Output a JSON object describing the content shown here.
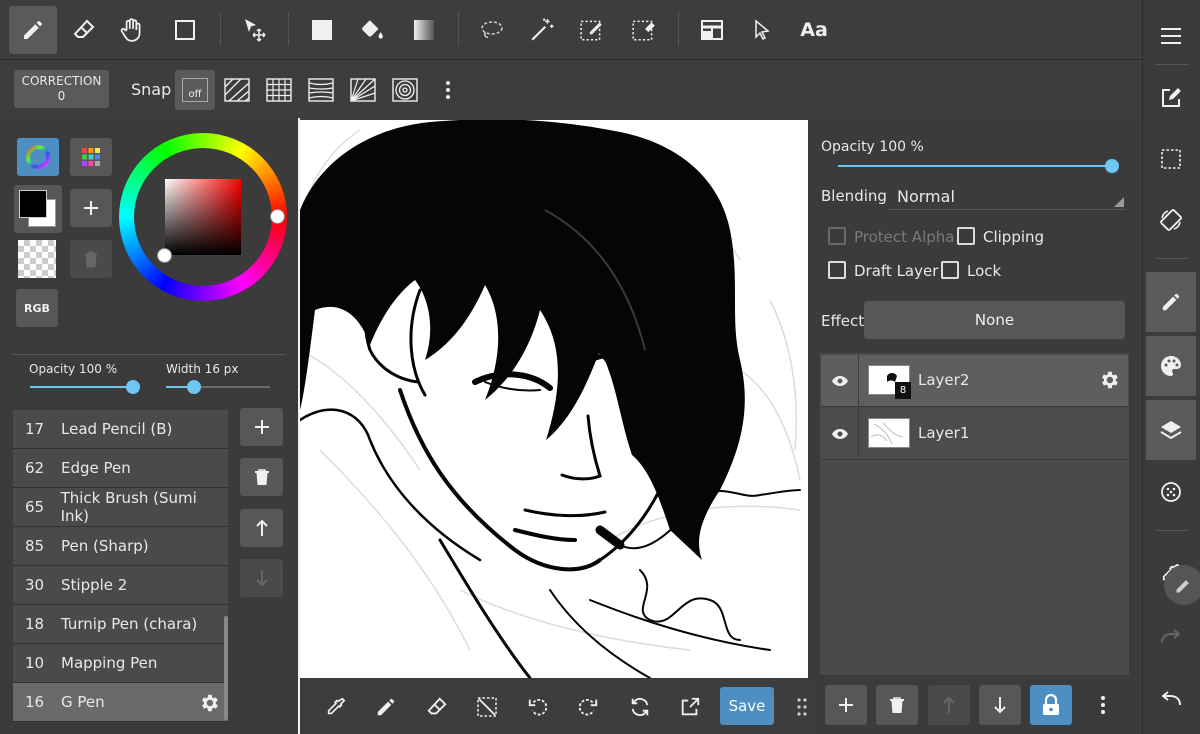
{
  "toolbar2": {
    "correction_label": "CORRECTION",
    "correction_value": "0",
    "snap_label": "Snap",
    "snap_off": "off"
  },
  "color_panel": {
    "rgb_label": "RGB",
    "primary_color": "#000000",
    "secondary_color": "#ffffff"
  },
  "brush_settings": {
    "opacity_label": "Opacity 100 %",
    "opacity_value": 100,
    "width_label": "Width 16 px",
    "width_value": 16
  },
  "brushes": [
    {
      "num": "17",
      "name": "Lead Pencil (B)"
    },
    {
      "num": "62",
      "name": "Edge Pen"
    },
    {
      "num": "65",
      "name": "Thick Brush (Sumi Ink)"
    },
    {
      "num": "85",
      "name": "Pen (Sharp)"
    },
    {
      "num": "30",
      "name": "Stipple 2"
    },
    {
      "num": "18",
      "name": "Turnip Pen (chara)"
    },
    {
      "num": "10",
      "name": "Mapping Pen"
    },
    {
      "num": "16",
      "name": "G Pen"
    }
  ],
  "selected_brush": "G Pen",
  "bottombar": {
    "save_label": "Save"
  },
  "layer_panel": {
    "opacity_label": "Opacity 100 %",
    "opacity_value": 100,
    "blending_label": "Blending",
    "blending_value": "Normal",
    "protect_alpha": "Protect Alpha",
    "clipping": "Clipping",
    "draft_layer": "Draft Layer",
    "lock": "Lock",
    "effect_label": "Effect",
    "effect_value": "None",
    "layers": [
      {
        "name": "Layer2",
        "badge": "8",
        "selected": true
      },
      {
        "name": "Layer1",
        "badge": "",
        "selected": false
      }
    ]
  },
  "topbar": {
    "text_tool_label": "Aa"
  },
  "colors": {
    "accent": "#6ec6f5",
    "save_button": "#4d8fc2",
    "panel": "#3b3b3b",
    "button": "#575757"
  }
}
